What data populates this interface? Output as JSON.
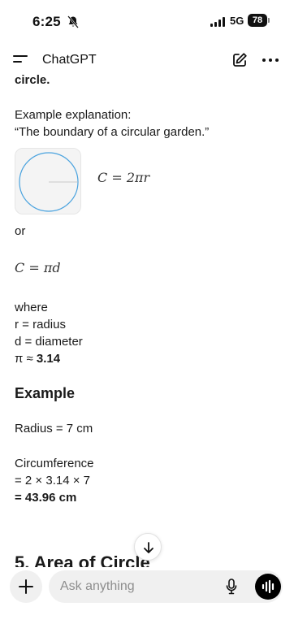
{
  "status": {
    "time": "6:25",
    "network": "5G",
    "battery": "78"
  },
  "header": {
    "title": "ChatGPT"
  },
  "content": {
    "top_fragment": "circle.",
    "example_label": "Example explanation:",
    "example_quote": "“The boundary of a circular garden.”",
    "formula_1": "C = 2πr",
    "or_label": "or",
    "formula_2": "C = πd",
    "where_label": "where",
    "def_r": "r = radius",
    "def_d": "d = diameter",
    "pi_prefix": "π ≈ ",
    "pi_value": "3.14",
    "example_heading": "Example",
    "radius_line": "Radius = 7 cm",
    "circumference_label": "Circumference",
    "calc_line": "= 2 × 3.14 × 7",
    "result_line": "= 43.96 cm",
    "next_heading": "5. Area of Circle"
  },
  "composer": {
    "placeholder": "Ask anything"
  },
  "icons": {
    "bell": "bell-slash-icon",
    "menu": "menu-icon",
    "edit": "new-chat-icon",
    "more": "more-icon",
    "scroll": "arrow-down-icon",
    "plus": "plus-icon",
    "mic": "mic-icon",
    "voice": "voice-mode-icon"
  },
  "colors": {
    "circle_stroke": "#4aa3df",
    "voice_button": "#000000"
  }
}
